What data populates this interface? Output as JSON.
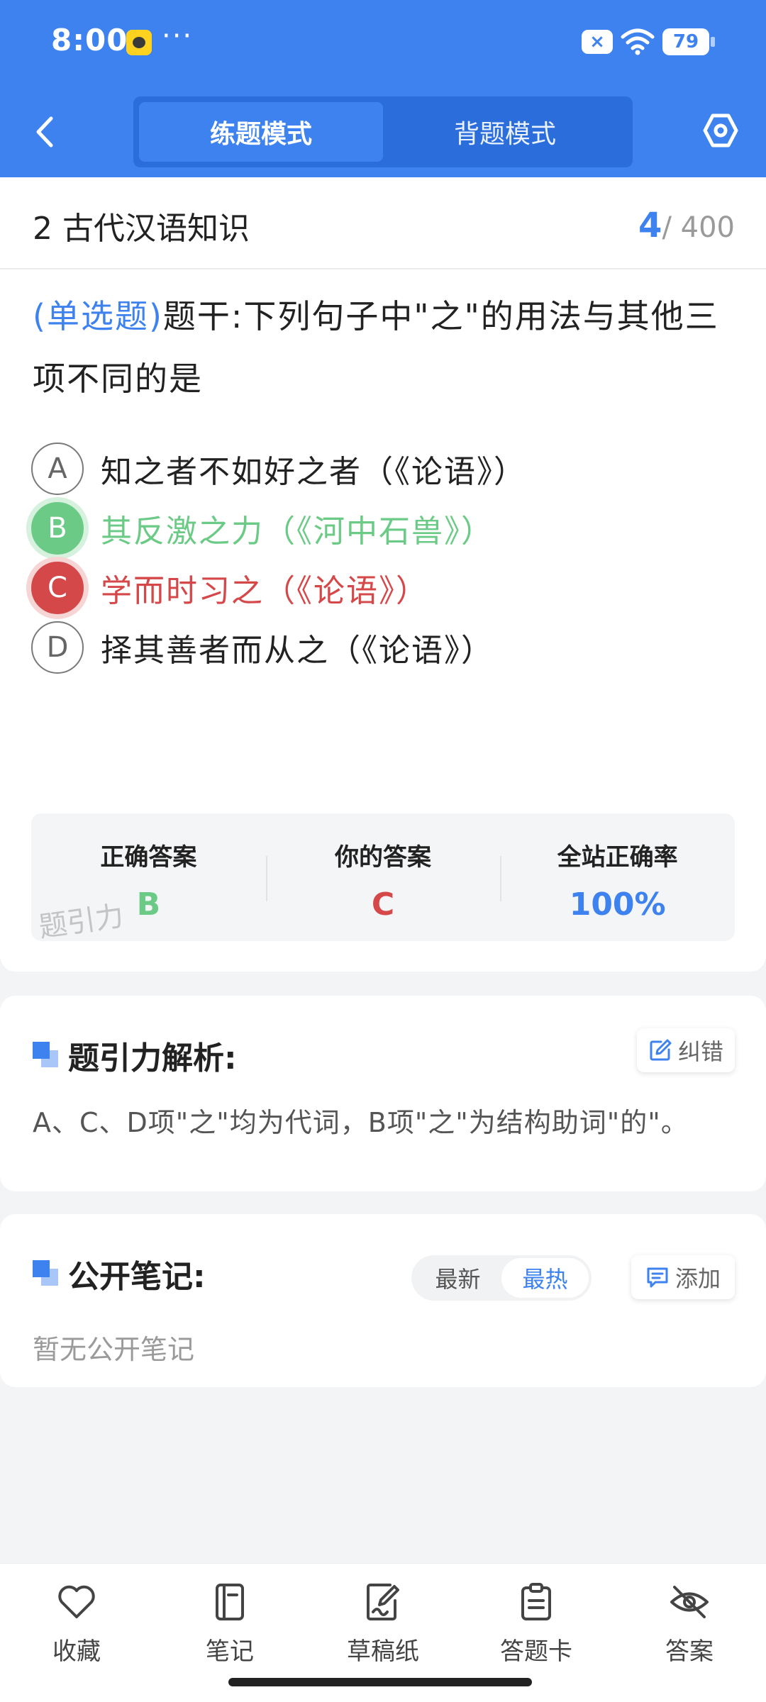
{
  "status_bar": {
    "time": "8:00",
    "dots": "···",
    "x_badge": "×",
    "battery": "79"
  },
  "header": {
    "tabs": [
      {
        "label": "练题模式",
        "active": true
      },
      {
        "label": "背题模式",
        "active": false
      }
    ],
    "icons": {
      "back": "chevron-left-icon",
      "settings": "hexagon-settings-icon"
    }
  },
  "question": {
    "section_title": "2 古代汉语知识",
    "current": "4",
    "total": "/ 400",
    "type_tag": "(单选题)",
    "stem": "题干:下列句子中\"之\"的用法与其他三项不同的是",
    "options": [
      {
        "letter": "A",
        "text": "知之者不如好之者（《论语》）",
        "state": "normal"
      },
      {
        "letter": "B",
        "text": "其反激之力（《河中石兽》）",
        "state": "correct"
      },
      {
        "letter": "C",
        "text": "学而时习之（《论语》）",
        "state": "wrong"
      },
      {
        "letter": "D",
        "text": "择其善者而从之（《论语》）",
        "state": "normal"
      }
    ],
    "answer_summary": {
      "correct_label": "正确答案",
      "correct_value": "B",
      "yours_label": "你的答案",
      "yours_value": "C",
      "rate_label": "全站正确率",
      "rate_value": "100%",
      "watermark": "题引力"
    }
  },
  "analysis": {
    "title": "题引力解析:",
    "correct_button": "纠错",
    "text": "A、C、D项\"之\"均为代词，B项\"之\"为结构助词\"的\"。"
  },
  "notes": {
    "title": "公开笔记:",
    "sort_tabs": [
      {
        "label": "最新",
        "active": false
      },
      {
        "label": "最热",
        "active": true
      }
    ],
    "add_button": "添加",
    "empty_text": "暂无公开笔记"
  },
  "bottom_nav": [
    {
      "label": "收藏",
      "icon": "heart-icon"
    },
    {
      "label": "笔记",
      "icon": "notebook-icon"
    },
    {
      "label": "草稿纸",
      "icon": "draft-paper-icon"
    },
    {
      "label": "答题卡",
      "icon": "answer-sheet-icon"
    },
    {
      "label": "答案",
      "icon": "eye-off-icon"
    }
  ],
  "colors": {
    "primary": "#3d82ef",
    "correct": "#6bcb86",
    "wrong": "#d5484a"
  }
}
